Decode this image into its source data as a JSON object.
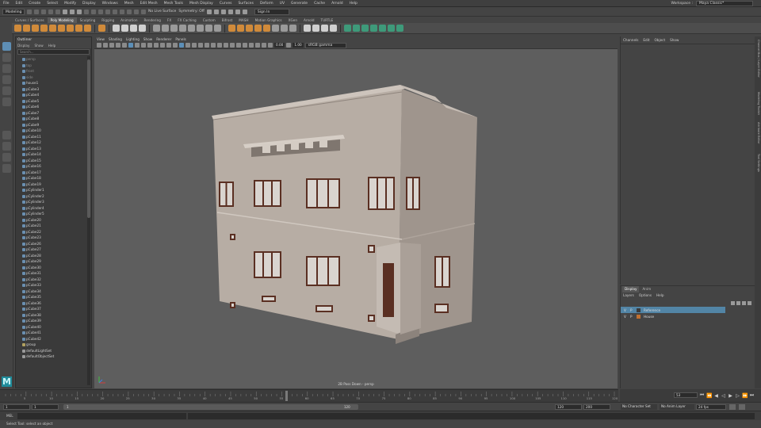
{
  "menubar": {
    "items": [
      "File",
      "Edit",
      "Create",
      "Select",
      "Modify",
      "Display",
      "Windows",
      "Mesh",
      "Edit Mesh",
      "Mesh Tools",
      "Mesh Display",
      "Curves",
      "Surfaces",
      "Deform",
      "UV",
      "Generate",
      "Cache",
      "Arnold",
      "Help"
    ],
    "workspace_label": "Workspace :",
    "workspace_value": "Maya Classic*"
  },
  "statusline": {
    "mode": "Modeling",
    "live_surface": "No Live Surface",
    "symmetry": "Symmetry: Off",
    "sign_in": "Sign In"
  },
  "shelf": {
    "tabs": [
      "Curves / Surfaces",
      "Poly Modeling",
      "Sculpting",
      "Rigging",
      "Animation",
      "Rendering",
      "FX",
      "FX Caching",
      "Custom",
      "Bifrost",
      "MASH",
      "Motion Graphics",
      "XGen",
      "Arnold",
      "TURTLE"
    ],
    "active_tab": "Poly Modeling"
  },
  "outliner": {
    "title": "Outliner",
    "menu": [
      "Display",
      "Show",
      "Help"
    ],
    "search_placeholder": "Search...",
    "items": [
      "persp",
      "top",
      "front",
      "side",
      "house1",
      "pCube3",
      "pCube4",
      "pCube5",
      "pCube6",
      "pCube7",
      "pCube8",
      "pCube9",
      "pCube10",
      "pCube11",
      "pCube12",
      "pCube13",
      "pCube14",
      "pCube15",
      "pCube16",
      "pCube17",
      "pCube18",
      "pCube19",
      "pCylinder1",
      "pCylinder2",
      "pCylinder3",
      "pCylinder4",
      "pCylinder5",
      "pCube20",
      "pCube21",
      "pCube22",
      "pCube23",
      "pCube26",
      "pCube27",
      "pCube28",
      "pCube29",
      "pCube30",
      "pCube31",
      "pCube32",
      "pCube33",
      "pCube34",
      "pCube35",
      "pCube36",
      "pCube37",
      "pCube38",
      "pCube39",
      "pCube40",
      "pCube41",
      "pCube42",
      "group",
      "defaultLightSet",
      "defaultObjectSet"
    ]
  },
  "viewport": {
    "menu": [
      "View",
      "Shading",
      "Lighting",
      "Show",
      "Renderer",
      "Panels"
    ],
    "exposure": "0.00",
    "gamma": "1.00",
    "color_space": "sRGB gamma",
    "camera_label": "2B Pass Down - persp",
    "colors": {
      "background": "#5e5e5e",
      "wall": "#b7ada4",
      "window_frame": "#5a2f22",
      "glass": "#d9d4cf"
    }
  },
  "channelbox": {
    "menu": [
      "Channels",
      "Edit",
      "Object",
      "Show"
    ]
  },
  "sidetabs": [
    "Channel Box / Layer Editor",
    "Modeling Toolkit",
    "Attribute Editor",
    "Tool Settings"
  ],
  "layers": {
    "tabs": [
      "Display",
      "Anim"
    ],
    "active_tab": "Display",
    "menu": [
      "Layers",
      "Options",
      "Help"
    ],
    "rows": [
      {
        "v": "V",
        "p": "P",
        "name": "Reference",
        "color": "#3a3a3a",
        "selected": true
      },
      {
        "v": "V",
        "p": "P",
        "name": "House",
        "color": "#c07030",
        "selected": false
      }
    ]
  },
  "timeslider": {
    "labels": [
      "5",
      "10",
      "15",
      "20",
      "25",
      "30",
      "35",
      "40",
      "45",
      "50",
      "55",
      "60",
      "65",
      "70",
      "75",
      "80",
      "85",
      "90",
      "95",
      "100",
      "105",
      "110",
      "115",
      "120"
    ],
    "current_frame": "53"
  },
  "rangeslider": {
    "start": "1",
    "inner_start": "1",
    "range_start_mark": "1",
    "range_end_mark": "120",
    "end": "120",
    "outer_end": "200",
    "character_set": "No Character Set",
    "anim_layer": "No Anim Layer",
    "fps": "24 fps"
  },
  "cmdline": {
    "label": "MEL"
  },
  "helpline": {
    "text": "Select Tool: select an object"
  }
}
